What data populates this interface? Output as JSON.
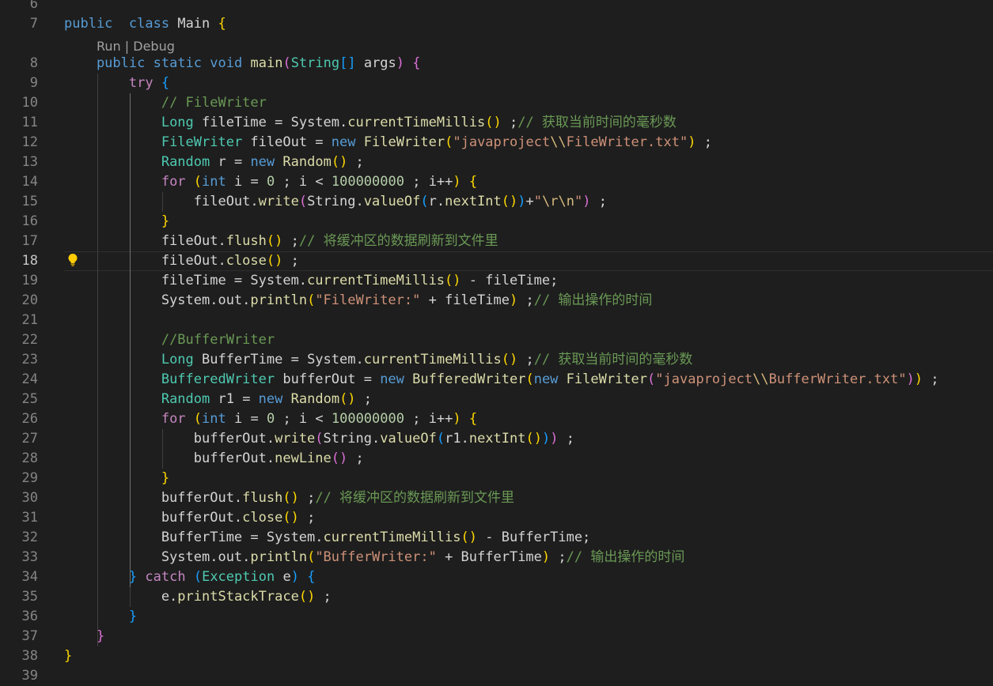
{
  "editor": {
    "codelens": "Run | Debug",
    "line_numbers": [
      "6",
      "7",
      "8",
      "9",
      "10",
      "11",
      "12",
      "13",
      "14",
      "15",
      "16",
      "17",
      "18",
      "19",
      "20",
      "21",
      "22",
      "23",
      "24",
      "25",
      "26",
      "27",
      "28",
      "29",
      "30",
      "31",
      "32",
      "33",
      "34",
      "35",
      "36",
      "37",
      "38",
      "39"
    ],
    "active_line": "18",
    "lines": [
      [],
      [
        [
          "k",
          "public"
        ],
        [
          "",
          "  "
        ],
        [
          "k",
          "class"
        ],
        [
          "",
          " Main "
        ],
        [
          "p1",
          "{"
        ]
      ],
      [
        [
          "k",
          "    public"
        ],
        [
          "",
          " "
        ],
        [
          "k",
          "static"
        ],
        [
          "",
          " "
        ],
        [
          "k",
          "void"
        ],
        [
          "",
          " "
        ],
        [
          "f",
          "main"
        ],
        [
          "p2",
          "("
        ],
        [
          "t",
          "String"
        ],
        [
          "p3",
          "[]"
        ],
        [
          "",
          " args"
        ],
        [
          "p2",
          ")"
        ],
        [
          "",
          " "
        ],
        [
          "p2",
          "{"
        ]
      ],
      [
        [
          "",
          "        "
        ],
        [
          "c",
          "try"
        ],
        [
          "",
          " "
        ],
        [
          "p3",
          "{"
        ]
      ],
      [
        [
          "",
          "            "
        ],
        [
          "cm",
          "// FileWriter"
        ]
      ],
      [
        [
          "",
          "            "
        ],
        [
          "t",
          "Long"
        ],
        [
          "",
          " fileTime = System."
        ],
        [
          "f",
          "currentTimeMillis"
        ],
        [
          "p1",
          "()"
        ],
        [
          "",
          " ;"
        ],
        [
          "cm",
          "// 获取当前时间的毫秒数"
        ]
      ],
      [
        [
          "",
          "            "
        ],
        [
          "t",
          "FileWriter"
        ],
        [
          "",
          " fileOut = "
        ],
        [
          "k",
          "new"
        ],
        [
          "",
          " "
        ],
        [
          "f",
          "FileWriter"
        ],
        [
          "p1",
          "("
        ],
        [
          "s",
          "\"javaproject"
        ],
        [
          "e",
          "\\\\"
        ],
        [
          "s",
          "FileWriter.txt\""
        ],
        [
          "p1",
          ")"
        ],
        [
          "",
          " ;"
        ]
      ],
      [
        [
          "",
          "            "
        ],
        [
          "t",
          "Random"
        ],
        [
          "",
          " r = "
        ],
        [
          "k",
          "new"
        ],
        [
          "",
          " "
        ],
        [
          "f",
          "Random"
        ],
        [
          "p1",
          "()"
        ],
        [
          "",
          " ;"
        ]
      ],
      [
        [
          "",
          "            "
        ],
        [
          "c",
          "for"
        ],
        [
          "",
          " "
        ],
        [
          "p1",
          "("
        ],
        [
          "k",
          "int"
        ],
        [
          "",
          " i = "
        ],
        [
          "n",
          "0"
        ],
        [
          "",
          " ; i < "
        ],
        [
          "n",
          "100000000"
        ],
        [
          "",
          " ; i++"
        ],
        [
          "p1",
          ")"
        ],
        [
          "",
          " "
        ],
        [
          "p1",
          "{"
        ]
      ],
      [
        [
          "",
          "                fileOut."
        ],
        [
          "f",
          "write"
        ],
        [
          "p2",
          "("
        ],
        [
          "",
          "String."
        ],
        [
          "f",
          "valueOf"
        ],
        [
          "p3",
          "("
        ],
        [
          "",
          "r."
        ],
        [
          "f",
          "nextInt"
        ],
        [
          "p1",
          "()"
        ],
        [
          "p3",
          ")"
        ],
        [
          "",
          "+"
        ],
        [
          "s",
          "\""
        ],
        [
          "e",
          "\\r\\n"
        ],
        [
          "s",
          "\""
        ],
        [
          "p2",
          ")"
        ],
        [
          "",
          " ;"
        ]
      ],
      [
        [
          "",
          "            "
        ],
        [
          "p1",
          "}"
        ]
      ],
      [
        [
          "",
          "            fileOut."
        ],
        [
          "f",
          "flush"
        ],
        [
          "p1",
          "()"
        ],
        [
          "",
          " ;"
        ],
        [
          "cm",
          "// 将缓冲区的数据刷新到文件里"
        ]
      ],
      [
        [
          "",
          "            fileOut."
        ],
        [
          "f",
          "close"
        ],
        [
          "p1",
          "()"
        ],
        [
          "",
          " ;"
        ]
      ],
      [
        [
          "",
          "            fileTime = System."
        ],
        [
          "f",
          "currentTimeMillis"
        ],
        [
          "p1",
          "()"
        ],
        [
          "",
          " - fileTime;"
        ]
      ],
      [
        [
          "",
          "            System.out."
        ],
        [
          "f",
          "println"
        ],
        [
          "p1",
          "("
        ],
        [
          "s",
          "\"FileWriter:\""
        ],
        [
          "",
          " + fileTime"
        ],
        [
          "p1",
          ")"
        ],
        [
          "",
          " ;"
        ],
        [
          "cm",
          "// 输出操作的时间"
        ]
      ],
      [],
      [
        [
          "",
          "            "
        ],
        [
          "cm",
          "//BufferWriter"
        ]
      ],
      [
        [
          "",
          "            "
        ],
        [
          "t",
          "Long"
        ],
        [
          "",
          " BufferTime = System."
        ],
        [
          "f",
          "currentTimeMillis"
        ],
        [
          "p1",
          "()"
        ],
        [
          "",
          " ;"
        ],
        [
          "cm",
          "// 获取当前时间的毫秒数"
        ]
      ],
      [
        [
          "",
          "            "
        ],
        [
          "t",
          "BufferedWriter"
        ],
        [
          "",
          " bufferOut = "
        ],
        [
          "k",
          "new"
        ],
        [
          "",
          " "
        ],
        [
          "f",
          "BufferedWriter"
        ],
        [
          "p1",
          "("
        ],
        [
          "k",
          "new"
        ],
        [
          "",
          " "
        ],
        [
          "f",
          "FileWriter"
        ],
        [
          "p2",
          "("
        ],
        [
          "s",
          "\"javaproject"
        ],
        [
          "e",
          "\\\\"
        ],
        [
          "s",
          "BufferWriter.txt\""
        ],
        [
          "p2",
          ")"
        ],
        [
          "p1",
          ")"
        ],
        [
          "",
          " ;"
        ]
      ],
      [
        [
          "",
          "            "
        ],
        [
          "t",
          "Random"
        ],
        [
          "",
          " r1 = "
        ],
        [
          "k",
          "new"
        ],
        [
          "",
          " "
        ],
        [
          "f",
          "Random"
        ],
        [
          "p1",
          "()"
        ],
        [
          "",
          " ;"
        ]
      ],
      [
        [
          "",
          "            "
        ],
        [
          "c",
          "for"
        ],
        [
          "",
          " "
        ],
        [
          "p1",
          "("
        ],
        [
          "k",
          "int"
        ],
        [
          "",
          " i = "
        ],
        [
          "n",
          "0"
        ],
        [
          "",
          " ; i < "
        ],
        [
          "n",
          "100000000"
        ],
        [
          "",
          " ; i++"
        ],
        [
          "p1",
          ")"
        ],
        [
          "",
          " "
        ],
        [
          "p1",
          "{"
        ]
      ],
      [
        [
          "",
          "                bufferOut."
        ],
        [
          "f",
          "write"
        ],
        [
          "p2",
          "("
        ],
        [
          "",
          "String."
        ],
        [
          "f",
          "valueOf"
        ],
        [
          "p3",
          "("
        ],
        [
          "",
          "r1."
        ],
        [
          "f",
          "nextInt"
        ],
        [
          "p1",
          "()"
        ],
        [
          "p3",
          ")"
        ],
        [
          "p2",
          ")"
        ],
        [
          "",
          " ;"
        ]
      ],
      [
        [
          "",
          "                bufferOut."
        ],
        [
          "f",
          "newLine"
        ],
        [
          "p2",
          "()"
        ],
        [
          "",
          " ;"
        ]
      ],
      [
        [
          "",
          "            "
        ],
        [
          "p1",
          "}"
        ]
      ],
      [
        [
          "",
          "            bufferOut."
        ],
        [
          "f",
          "flush"
        ],
        [
          "p1",
          "()"
        ],
        [
          "",
          " ;"
        ],
        [
          "cm",
          "// 将缓冲区的数据刷新到文件里"
        ]
      ],
      [
        [
          "",
          "            bufferOut."
        ],
        [
          "f",
          "close"
        ],
        [
          "p1",
          "()"
        ],
        [
          "",
          " ;"
        ]
      ],
      [
        [
          "",
          "            BufferTime = System."
        ],
        [
          "f",
          "currentTimeMillis"
        ],
        [
          "p1",
          "()"
        ],
        [
          "",
          " - BufferTime;"
        ]
      ],
      [
        [
          "",
          "            System.out."
        ],
        [
          "f",
          "println"
        ],
        [
          "p1",
          "("
        ],
        [
          "s",
          "\"BufferWriter:\""
        ],
        [
          "",
          " + BufferTime"
        ],
        [
          "p1",
          ")"
        ],
        [
          "",
          " ;"
        ],
        [
          "cm",
          "// 输出操作的时间"
        ]
      ],
      [
        [
          "",
          "        "
        ],
        [
          "p3",
          "}"
        ],
        [
          "",
          " "
        ],
        [
          "c",
          "catch"
        ],
        [
          "",
          " "
        ],
        [
          "p3",
          "("
        ],
        [
          "t",
          "Exception"
        ],
        [
          "",
          " e"
        ],
        [
          "p3",
          ")"
        ],
        [
          "",
          " "
        ],
        [
          "p3",
          "{"
        ]
      ],
      [
        [
          "",
          "            e."
        ],
        [
          "f",
          "printStackTrace"
        ],
        [
          "p1",
          "()"
        ],
        [
          "",
          " ;"
        ]
      ],
      [
        [
          "",
          "        "
        ],
        [
          "p3",
          "}"
        ]
      ],
      [
        [
          "",
          "    "
        ],
        [
          "p2",
          "}"
        ]
      ],
      [
        [
          "p1",
          "}"
        ]
      ],
      []
    ]
  }
}
